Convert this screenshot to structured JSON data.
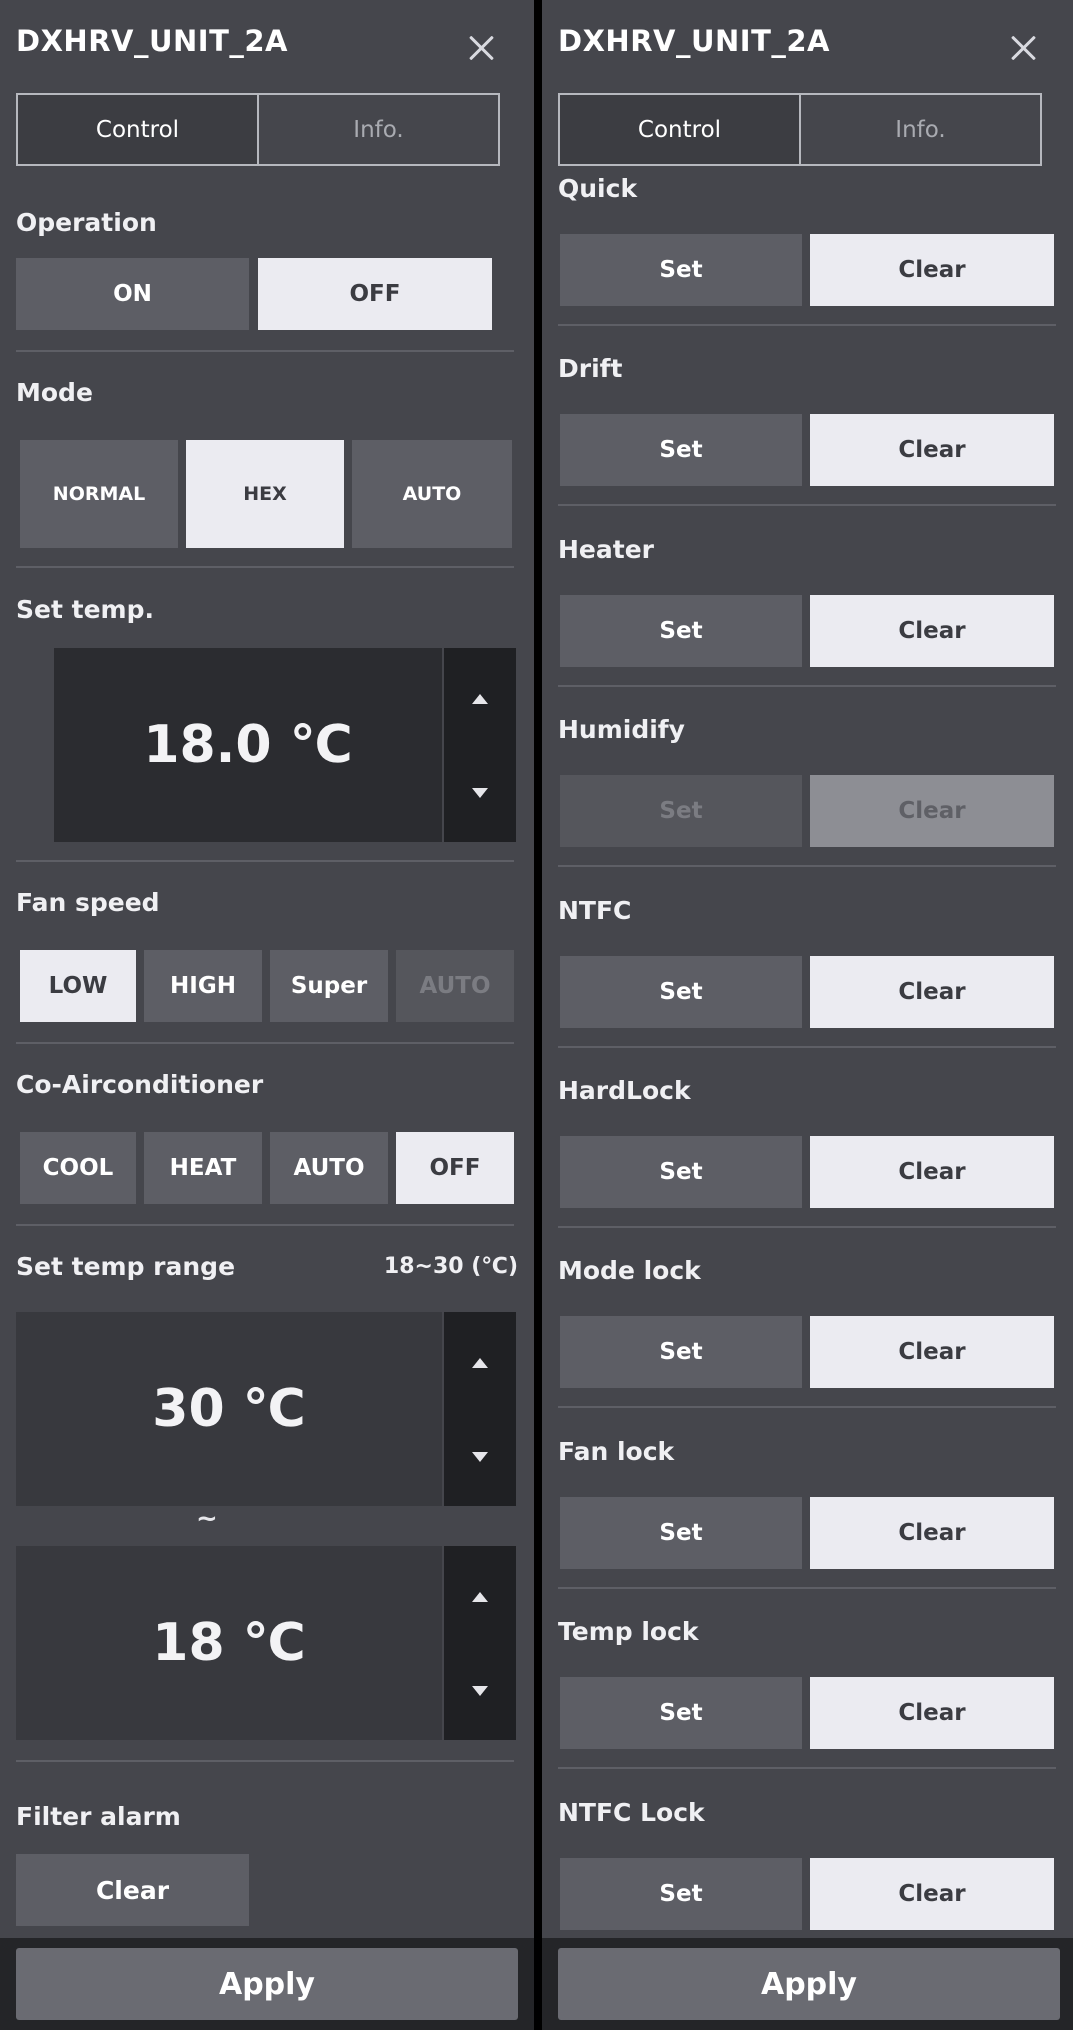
{
  "left": {
    "title": "DXHRV_UNIT_2A",
    "tabs": [
      "Control",
      "Info."
    ],
    "operation": {
      "label": "Operation",
      "on": "ON",
      "off": "OFF",
      "selected": "OFF"
    },
    "mode": {
      "label": "Mode",
      "options": [
        "NORMAL",
        "HEX",
        "AUTO"
      ],
      "selected": "HEX"
    },
    "set_temp": {
      "label": "Set temp.",
      "value": "18.0 ℃"
    },
    "fan_speed": {
      "label": "Fan speed",
      "options": [
        "LOW",
        "HIGH",
        "Super",
        "AUTO"
      ],
      "selected": "LOW",
      "disabled": "AUTO"
    },
    "co_aircon": {
      "label": "Co-Airconditioner",
      "options": [
        "COOL",
        "HEAT",
        "AUTO",
        "OFF"
      ],
      "selected": "OFF"
    },
    "temp_range": {
      "label": "Set temp range",
      "range_text": "18~30 (℃)",
      "upper": "30 ℃",
      "separator": "~",
      "lower": "18 ℃"
    },
    "filter_alarm": {
      "label": "Filter alarm",
      "clear": "Clear"
    },
    "apply": "Apply"
  },
  "right": {
    "title": "DXHRV_UNIT_2A",
    "tabs": [
      "Control",
      "Info."
    ],
    "set_label": "Set",
    "clear_label": "Clear",
    "rows": [
      {
        "label": "Quick",
        "disabled": false
      },
      {
        "label": "Drift",
        "disabled": false
      },
      {
        "label": "Heater",
        "disabled": false
      },
      {
        "label": "Humidify",
        "disabled": true
      },
      {
        "label": "NTFC",
        "disabled": false
      },
      {
        "label": "HardLock",
        "disabled": false
      },
      {
        "label": "Mode lock",
        "disabled": false
      },
      {
        "label": "Fan lock",
        "disabled": false
      },
      {
        "label": "Temp lock",
        "disabled": false
      },
      {
        "label": "NTFC Lock",
        "disabled": false
      }
    ],
    "apply": "Apply"
  },
  "colors": {
    "panel_bg": "#45464c",
    "button_dark": "#5d5e65",
    "button_light": "#ebebf1",
    "display_bg": "#2b2c30",
    "apply_bg": "#6a6b72"
  }
}
